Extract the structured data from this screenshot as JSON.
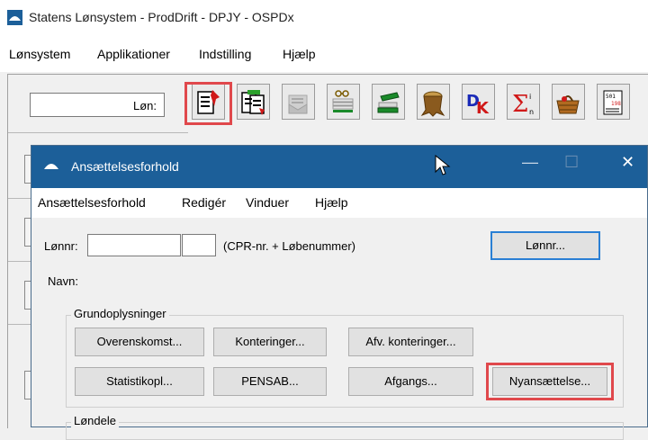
{
  "outer_window": {
    "title": "Statens Lønsystem - ProdDrift - DPJY - OSPDx",
    "menu": [
      "Lønsystem",
      "Applikationer",
      "Indstilling",
      "Hjælp"
    ],
    "lon_label": "Løn:",
    "toolbar_icons": [
      "employment-records-icon",
      "documents-icon",
      "mail-icon",
      "glasses-pages-icon",
      "book-stack-icon",
      "tree-stump-icon",
      "dk-icon",
      "sum-icon",
      "basket-icon",
      "calculator-icon"
    ]
  },
  "dialog": {
    "title": "Ansættelsesforhold",
    "window_controls": [
      "—",
      "☐",
      "✕"
    ],
    "menu": [
      "Ansættelsesforhold",
      "Redigér",
      "Vinduer",
      "Hjælp"
    ],
    "lonnr_label": "Lønnr:",
    "lonnr_value": "",
    "lobenummer_value": "",
    "lonnr_hint": "(CPR-nr. + Løbenummer)",
    "lonnr_button": "Lønnr...",
    "navn_label": "Navn:",
    "group_title": "Grundoplysninger",
    "buttons_row1": [
      "Overenskomst...",
      "Konteringer...",
      "Afv. konteringer..."
    ],
    "buttons_row2": [
      "Statistikopl...",
      "PENSAB...",
      "Afgangs...",
      "Nyansættelse..."
    ],
    "group2_title": "Løndele"
  },
  "colors": {
    "title_bar": "#1c5f99",
    "highlight": "#e0484c",
    "primary_border": "#2a7fd4"
  }
}
